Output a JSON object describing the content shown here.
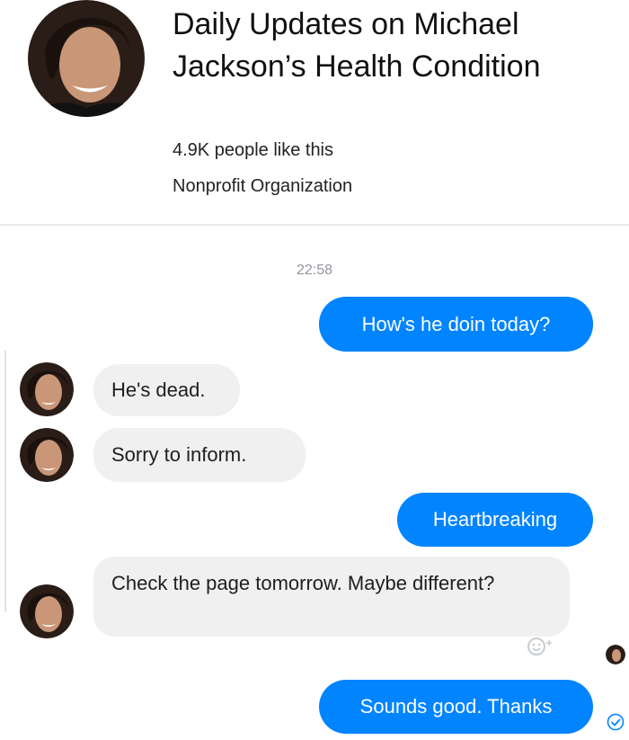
{
  "page": {
    "title": "Daily Updates on Michael Jackson’s Health Condition",
    "likes": "4.9K people like this",
    "category": "Nonprofit Organization"
  },
  "thread": {
    "timestamp": "22:58",
    "messages": [
      {
        "direction": "outgoing",
        "text": "How's he doin today?"
      },
      {
        "direction": "incoming",
        "text": "He's dead."
      },
      {
        "direction": "incoming",
        "text": "Sorry to inform."
      },
      {
        "direction": "outgoing",
        "text": "Heartbreaking"
      },
      {
        "direction": "incoming",
        "text": "Check the page tomorrow. Maybe different?"
      },
      {
        "direction": "outgoing",
        "text": "Sounds good. Thanks"
      }
    ]
  },
  "icons": {
    "react": "add-reaction-icon",
    "delivered": "delivered-check-icon"
  },
  "colors": {
    "outgoing_bubble": "#0084ff",
    "incoming_bubble": "#f1f0f0",
    "timestamp": "#90949c"
  }
}
